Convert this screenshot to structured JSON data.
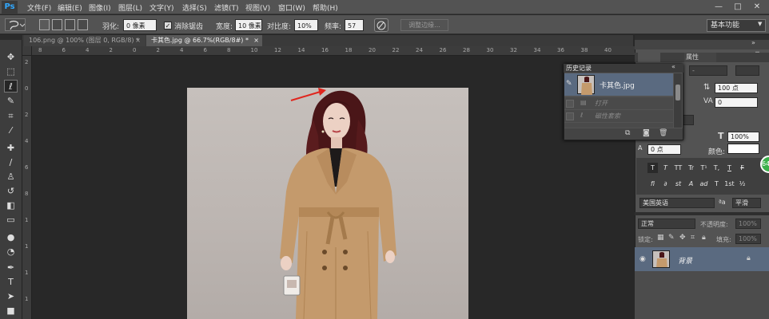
{
  "app": {
    "logo": "Ps",
    "menu": [
      "文件(F)",
      "编辑(E)",
      "图像(I)",
      "图层(L)",
      "文字(Y)",
      "选择(S)",
      "滤镜(T)",
      "视图(V)",
      "窗口(W)",
      "帮助(H)"
    ],
    "window_buttons": [
      "—",
      "□",
      "✕"
    ]
  },
  "options": {
    "feather_label": "羽化:",
    "feather_value": "0 像素",
    "antialias_label": "消除锯齿",
    "width_label": "宽度:",
    "width_value": "10 像素",
    "contrast_label": "对比度:",
    "contrast_value": "10%",
    "frequency_label": "频率:",
    "frequency_value": "57",
    "refine_edge": "调整边缘...",
    "workspace": "基本功能"
  },
  "tabs": [
    {
      "label": "106.png @ 100% (图层 0, RGB/8) *",
      "close": "×"
    },
    {
      "label": "卡其色.jpg @ 66.7%(RGB/8#) *",
      "close": "×"
    }
  ],
  "ruler": {
    "top_ticks": [
      "8",
      "6",
      "4",
      "2",
      "0",
      "2",
      "4",
      "6",
      "8",
      "10",
      "12",
      "14",
      "16",
      "18",
      "20",
      "22",
      "24",
      "26",
      "28",
      "30",
      "32",
      "34",
      "36",
      "38",
      "40"
    ],
    "left_ticks": [
      "2",
      "0",
      "2",
      "4",
      "6",
      "8",
      "1",
      "1",
      "1",
      "1"
    ]
  },
  "history": {
    "title": "历史记录",
    "snapshot_label": "卡其色.jpg",
    "items": [
      "打开",
      "磁性套索"
    ]
  },
  "character": {
    "tab_label": "属性",
    "size_value": "100 点",
    "tracking_value": "0",
    "vscale_value": "100%",
    "baseline_value": "0 点",
    "color_label": "颜色:",
    "tt_buttons": [
      "T",
      "T",
      "TT",
      "Tr",
      "T¹",
      "T,",
      "T",
      "F"
    ],
    "ligature_buttons": [
      "fi",
      "∂",
      "st",
      "A",
      "ad",
      "T",
      "1st",
      "½"
    ],
    "language": "美国英语",
    "aa_prefix": "ªa",
    "aa_value": "平滑"
  },
  "layers": {
    "blend_mode": "正常",
    "opacity_label": "不透明度:",
    "opacity_value": "100%",
    "lock_label": "锁定:",
    "fill_label": "填充:",
    "fill_value": "100%",
    "layer_name": "背景"
  },
  "badge": "64"
}
